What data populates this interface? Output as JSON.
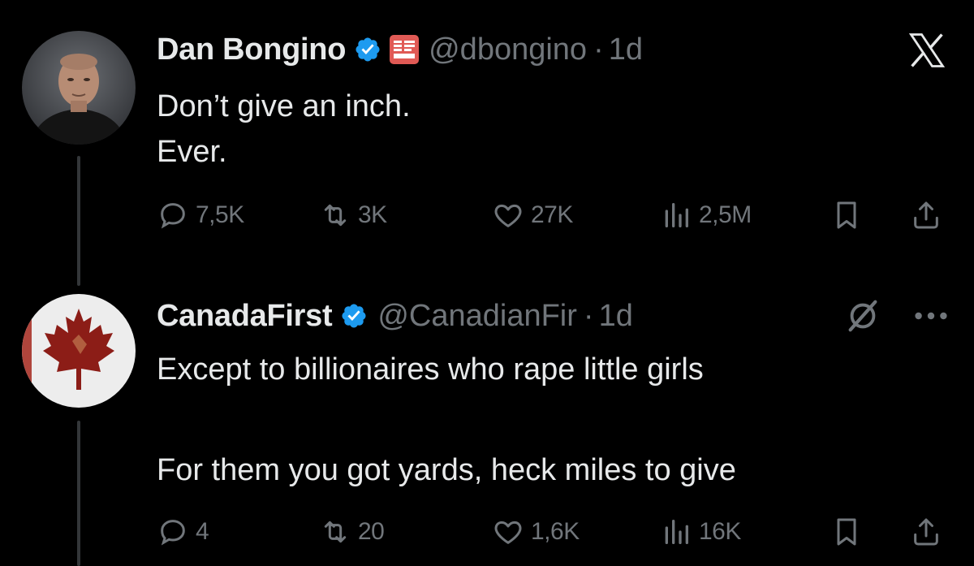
{
  "colors": {
    "background": "#000000",
    "text": "#e7e9ea",
    "muted": "#71767b",
    "verified": "#1d9bf0",
    "thread_line": "#333639"
  },
  "tweet1": {
    "name": "Dan Bongino",
    "handle": "@dbongino",
    "separator": "·",
    "time": "1d",
    "lines": [
      "Don’t give an inch.",
      "Ever."
    ],
    "stats": {
      "replies": "7,5K",
      "reposts": "3K",
      "likes": "27K",
      "views": "2,5M"
    },
    "corner_icon": "x-logo-icon"
  },
  "tweet2": {
    "name": "CanadaFirst",
    "handle": "@CanadianFir",
    "separator": "·",
    "time": "1d",
    "lines": [
      "Except to billionaires who rape little girls",
      "",
      "For them you got yards, heck miles to give"
    ],
    "stats": {
      "replies": "4",
      "reposts": "20",
      "likes": "1,6K",
      "views": "16K"
    },
    "corner_icons": [
      "grok-icon",
      "more-icon"
    ]
  }
}
